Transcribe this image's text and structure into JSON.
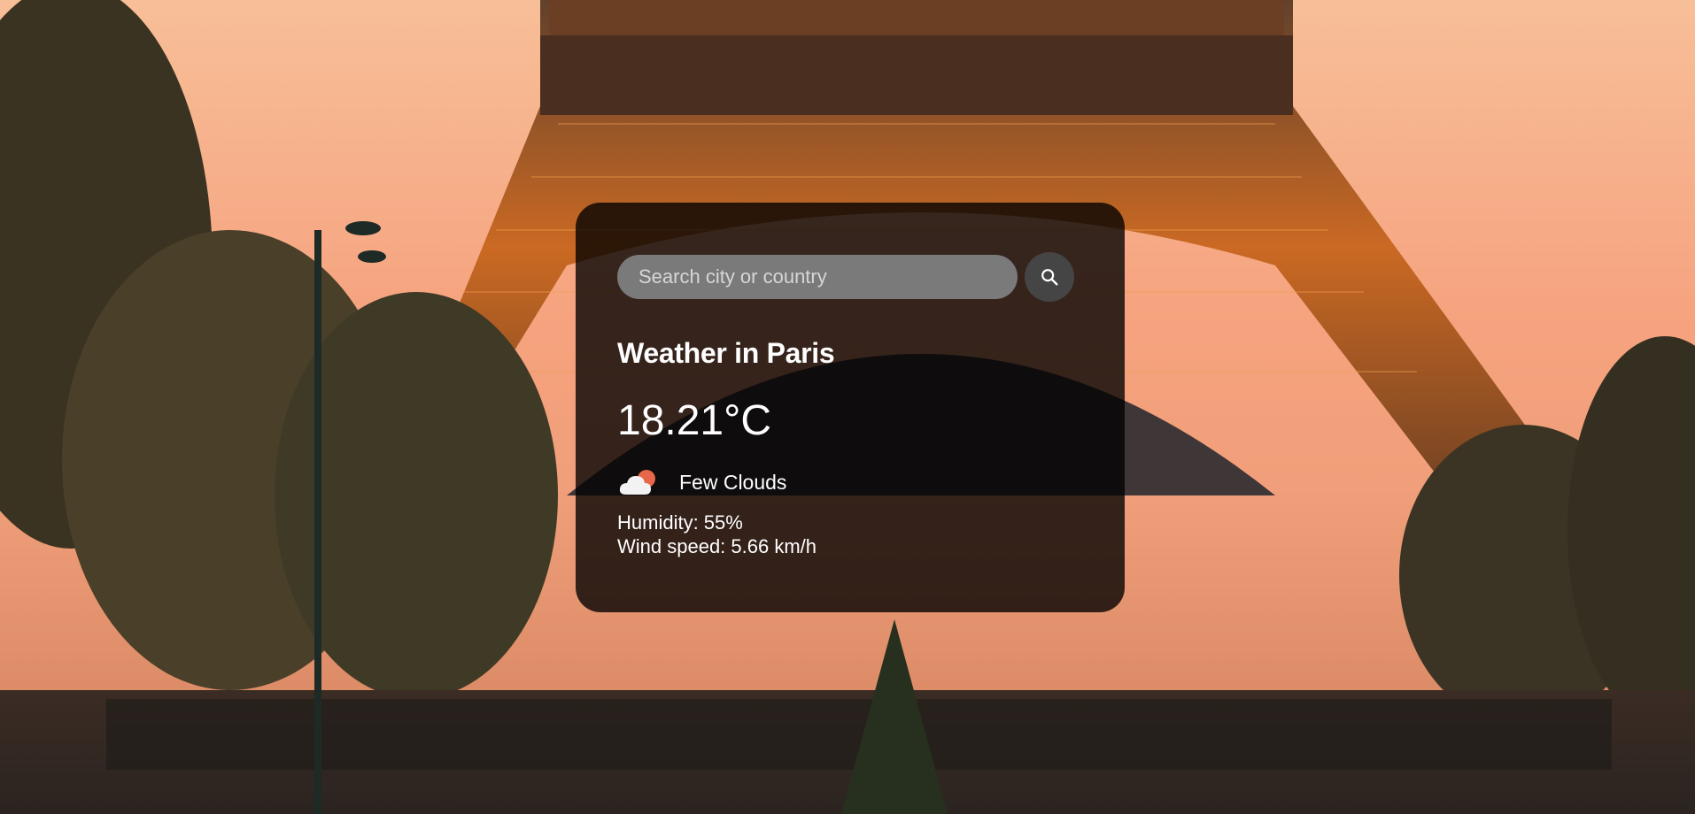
{
  "search": {
    "placeholder": "Search city or country",
    "value": ""
  },
  "weather": {
    "title": "Weather in Paris",
    "temperature": "18.21°C",
    "description": "Few Clouds",
    "humidity": "Humidity: 55%",
    "wind": "Wind speed: 5.66 km/h",
    "icon": "few-clouds-icon"
  },
  "colors": {
    "card_background": "#000000",
    "search_field": "#7a7a7a",
    "search_button": "#454545",
    "text": "#ffffff",
    "sky": "#f5a47e",
    "sun_accent": "#e8664a"
  },
  "icons": {
    "search": "magnifier-icon"
  }
}
